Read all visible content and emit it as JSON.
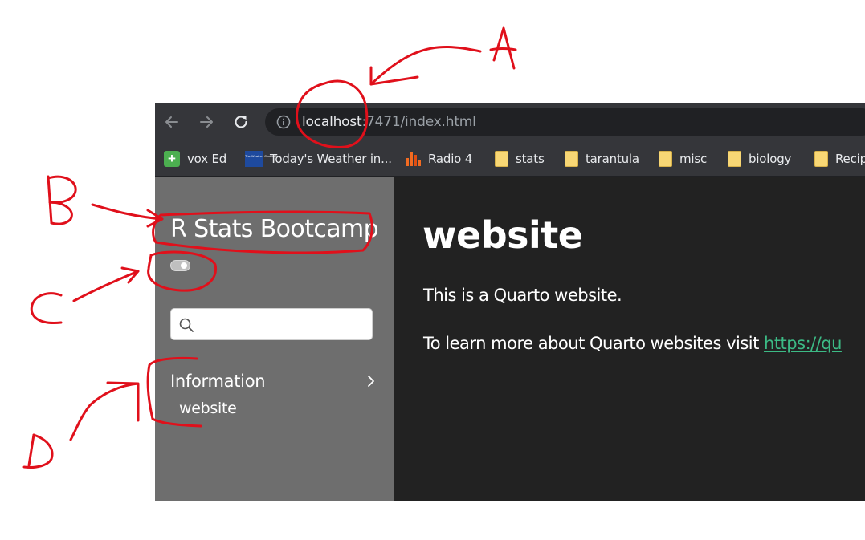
{
  "browser": {
    "url_host": "localhost",
    "url_rest": ":7471/index.html",
    "icons": [
      "back-arrow-icon",
      "forward-arrow-icon",
      "reload-icon",
      "site-info-icon"
    ]
  },
  "bookmarks": [
    {
      "label": "vox Ed",
      "icon": "plus-icon"
    },
    {
      "label": "Today's Weather in...",
      "icon": "weather-channel-icon"
    },
    {
      "label": "Radio 4",
      "icon": "radio-bars-icon"
    },
    {
      "label": "stats",
      "icon": "folder-icon"
    },
    {
      "label": "tarantula",
      "icon": "folder-icon"
    },
    {
      "label": "misc",
      "icon": "folder-icon"
    },
    {
      "label": "biology",
      "icon": "folder-icon"
    },
    {
      "label": "Recip",
      "icon": "folder-icon"
    }
  ],
  "weather_logo_text": "The Weather Channel",
  "sidebar": {
    "site_title": "R Stats Bootcamp",
    "search_placeholder": "",
    "section_label": "Information",
    "items": [
      "website"
    ]
  },
  "main": {
    "title": "website",
    "paragraph1": "This is a Quarto website.",
    "paragraph2_prefix": "To learn more about Quarto websites visit ",
    "paragraph2_link": "https://qu"
  },
  "annotations": {
    "labels": [
      "A",
      "B",
      "C",
      "D"
    ],
    "color": "#e0101b"
  },
  "colors": {
    "browser_toolbar": "#35363a",
    "omnibox": "#202124",
    "sidebar_bg": "#6e6e6e",
    "main_bg": "#222222",
    "link": "#3cba85"
  }
}
